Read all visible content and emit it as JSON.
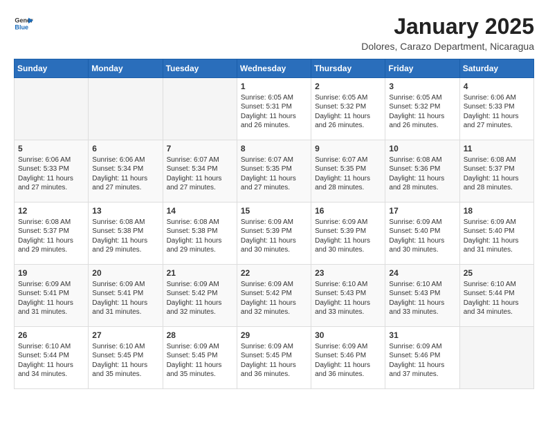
{
  "header": {
    "logo_line1": "General",
    "logo_line2": "Blue",
    "title": "January 2025",
    "subtitle": "Dolores, Carazo Department, Nicaragua"
  },
  "calendar": {
    "days_of_week": [
      "Sunday",
      "Monday",
      "Tuesday",
      "Wednesday",
      "Thursday",
      "Friday",
      "Saturday"
    ],
    "weeks": [
      [
        {
          "day": "",
          "info": ""
        },
        {
          "day": "",
          "info": ""
        },
        {
          "day": "",
          "info": ""
        },
        {
          "day": "1",
          "info": "Sunrise: 6:05 AM\nSunset: 5:31 PM\nDaylight: 11 hours and 26 minutes."
        },
        {
          "day": "2",
          "info": "Sunrise: 6:05 AM\nSunset: 5:32 PM\nDaylight: 11 hours and 26 minutes."
        },
        {
          "day": "3",
          "info": "Sunrise: 6:05 AM\nSunset: 5:32 PM\nDaylight: 11 hours and 26 minutes."
        },
        {
          "day": "4",
          "info": "Sunrise: 6:06 AM\nSunset: 5:33 PM\nDaylight: 11 hours and 27 minutes."
        }
      ],
      [
        {
          "day": "5",
          "info": "Sunrise: 6:06 AM\nSunset: 5:33 PM\nDaylight: 11 hours and 27 minutes."
        },
        {
          "day": "6",
          "info": "Sunrise: 6:06 AM\nSunset: 5:34 PM\nDaylight: 11 hours and 27 minutes."
        },
        {
          "day": "7",
          "info": "Sunrise: 6:07 AM\nSunset: 5:34 PM\nDaylight: 11 hours and 27 minutes."
        },
        {
          "day": "8",
          "info": "Sunrise: 6:07 AM\nSunset: 5:35 PM\nDaylight: 11 hours and 27 minutes."
        },
        {
          "day": "9",
          "info": "Sunrise: 6:07 AM\nSunset: 5:35 PM\nDaylight: 11 hours and 28 minutes."
        },
        {
          "day": "10",
          "info": "Sunrise: 6:08 AM\nSunset: 5:36 PM\nDaylight: 11 hours and 28 minutes."
        },
        {
          "day": "11",
          "info": "Sunrise: 6:08 AM\nSunset: 5:37 PM\nDaylight: 11 hours and 28 minutes."
        }
      ],
      [
        {
          "day": "12",
          "info": "Sunrise: 6:08 AM\nSunset: 5:37 PM\nDaylight: 11 hours and 29 minutes."
        },
        {
          "day": "13",
          "info": "Sunrise: 6:08 AM\nSunset: 5:38 PM\nDaylight: 11 hours and 29 minutes."
        },
        {
          "day": "14",
          "info": "Sunrise: 6:08 AM\nSunset: 5:38 PM\nDaylight: 11 hours and 29 minutes."
        },
        {
          "day": "15",
          "info": "Sunrise: 6:09 AM\nSunset: 5:39 PM\nDaylight: 11 hours and 30 minutes."
        },
        {
          "day": "16",
          "info": "Sunrise: 6:09 AM\nSunset: 5:39 PM\nDaylight: 11 hours and 30 minutes."
        },
        {
          "day": "17",
          "info": "Sunrise: 6:09 AM\nSunset: 5:40 PM\nDaylight: 11 hours and 30 minutes."
        },
        {
          "day": "18",
          "info": "Sunrise: 6:09 AM\nSunset: 5:40 PM\nDaylight: 11 hours and 31 minutes."
        }
      ],
      [
        {
          "day": "19",
          "info": "Sunrise: 6:09 AM\nSunset: 5:41 PM\nDaylight: 11 hours and 31 minutes."
        },
        {
          "day": "20",
          "info": "Sunrise: 6:09 AM\nSunset: 5:41 PM\nDaylight: 11 hours and 31 minutes."
        },
        {
          "day": "21",
          "info": "Sunrise: 6:09 AM\nSunset: 5:42 PM\nDaylight: 11 hours and 32 minutes."
        },
        {
          "day": "22",
          "info": "Sunrise: 6:09 AM\nSunset: 5:42 PM\nDaylight: 11 hours and 32 minutes."
        },
        {
          "day": "23",
          "info": "Sunrise: 6:10 AM\nSunset: 5:43 PM\nDaylight: 11 hours and 33 minutes."
        },
        {
          "day": "24",
          "info": "Sunrise: 6:10 AM\nSunset: 5:43 PM\nDaylight: 11 hours and 33 minutes."
        },
        {
          "day": "25",
          "info": "Sunrise: 6:10 AM\nSunset: 5:44 PM\nDaylight: 11 hours and 34 minutes."
        }
      ],
      [
        {
          "day": "26",
          "info": "Sunrise: 6:10 AM\nSunset: 5:44 PM\nDaylight: 11 hours and 34 minutes."
        },
        {
          "day": "27",
          "info": "Sunrise: 6:10 AM\nSunset: 5:45 PM\nDaylight: 11 hours and 35 minutes."
        },
        {
          "day": "28",
          "info": "Sunrise: 6:09 AM\nSunset: 5:45 PM\nDaylight: 11 hours and 35 minutes."
        },
        {
          "day": "29",
          "info": "Sunrise: 6:09 AM\nSunset: 5:45 PM\nDaylight: 11 hours and 36 minutes."
        },
        {
          "day": "30",
          "info": "Sunrise: 6:09 AM\nSunset: 5:46 PM\nDaylight: 11 hours and 36 minutes."
        },
        {
          "day": "31",
          "info": "Sunrise: 6:09 AM\nSunset: 5:46 PM\nDaylight: 11 hours and 37 minutes."
        },
        {
          "day": "",
          "info": ""
        }
      ]
    ]
  }
}
